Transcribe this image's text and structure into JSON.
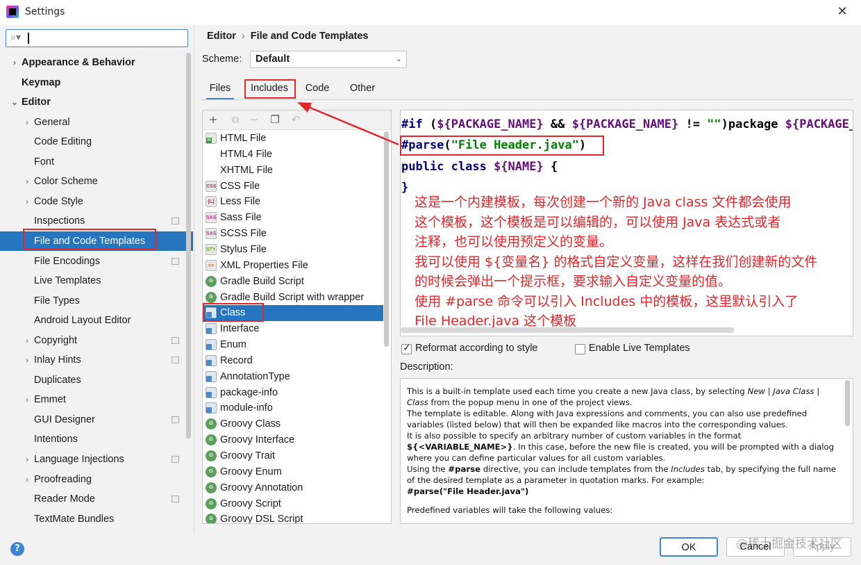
{
  "window": {
    "title": "Settings",
    "close_glyph": "✕"
  },
  "search": {
    "value": "",
    "icon": "search-icon"
  },
  "sidebar": {
    "items": [
      {
        "label": "Appearance & Behavior",
        "level": 0,
        "bold": true,
        "expander": "›"
      },
      {
        "label": "Keymap",
        "level": 0,
        "bold": true,
        "expander": ""
      },
      {
        "label": "Editor",
        "level": 0,
        "bold": true,
        "expander": "⌄"
      },
      {
        "label": "General",
        "level": 1,
        "expander": "›"
      },
      {
        "label": "Code Editing",
        "level": 1,
        "expander": ""
      },
      {
        "label": "Font",
        "level": 1,
        "expander": ""
      },
      {
        "label": "Color Scheme",
        "level": 1,
        "expander": "›"
      },
      {
        "label": "Code Style",
        "level": 1,
        "expander": "›"
      },
      {
        "label": "Inspections",
        "level": 1,
        "expander": "",
        "marker": true
      },
      {
        "label": "File and Code Templates",
        "level": 1,
        "expander": "",
        "selected": true
      },
      {
        "label": "File Encodings",
        "level": 1,
        "expander": "",
        "marker": true
      },
      {
        "label": "Live Templates",
        "level": 1,
        "expander": ""
      },
      {
        "label": "File Types",
        "level": 1,
        "expander": ""
      },
      {
        "label": "Android Layout Editor",
        "level": 1,
        "expander": ""
      },
      {
        "label": "Copyright",
        "level": 1,
        "expander": "›",
        "marker": true
      },
      {
        "label": "Inlay Hints",
        "level": 1,
        "expander": "›",
        "marker": true
      },
      {
        "label": "Duplicates",
        "level": 1,
        "expander": ""
      },
      {
        "label": "Emmet",
        "level": 1,
        "expander": "›"
      },
      {
        "label": "GUI Designer",
        "level": 1,
        "expander": "",
        "marker": true
      },
      {
        "label": "Intentions",
        "level": 1,
        "expander": ""
      },
      {
        "label": "Language Injections",
        "level": 1,
        "expander": "›",
        "marker": true
      },
      {
        "label": "Proofreading",
        "level": 1,
        "expander": "›"
      },
      {
        "label": "Reader Mode",
        "level": 1,
        "expander": "",
        "marker": true
      },
      {
        "label": "TextMate Bundles",
        "level": 1,
        "expander": ""
      }
    ]
  },
  "breadcrumb": {
    "parent": "Editor",
    "separator": "›",
    "current": "File and Code Templates"
  },
  "scheme": {
    "label": "Scheme:",
    "value": "Default",
    "dropdown_glyph": "⌄"
  },
  "tabs": [
    {
      "label": "Files",
      "active": true
    },
    {
      "label": "Includes"
    },
    {
      "label": "Code"
    },
    {
      "label": "Other"
    }
  ],
  "toolbar": {
    "add": "+",
    "copy": "⧉",
    "remove": "−",
    "duplicate": "❐",
    "reset": "↶"
  },
  "templates": [
    {
      "label": "HTML File",
      "icon": "html"
    },
    {
      "label": "HTML4 File",
      "icon": "html4"
    },
    {
      "label": "XHTML File",
      "icon": "xhtml"
    },
    {
      "label": "CSS File",
      "icon": "css",
      "glyph": "CSS"
    },
    {
      "label": "Less File",
      "icon": "less",
      "glyph": "{L}"
    },
    {
      "label": "Sass File",
      "icon": "sass",
      "glyph": "SASS"
    },
    {
      "label": "SCSS File",
      "icon": "sass",
      "glyph": "SASS"
    },
    {
      "label": "Stylus File",
      "icon": "styl",
      "glyph": "STYL"
    },
    {
      "label": "XML Properties File",
      "icon": "xml",
      "glyph": "<>"
    },
    {
      "label": "Gradle Build Script",
      "icon": "gradle",
      "glyph": "G"
    },
    {
      "label": "Gradle Build Script with wrapper",
      "icon": "gradle",
      "glyph": "G"
    },
    {
      "label": "Class",
      "icon": "java",
      "selected": true
    },
    {
      "label": "Interface",
      "icon": "java"
    },
    {
      "label": "Enum",
      "icon": "java"
    },
    {
      "label": "Record",
      "icon": "java"
    },
    {
      "label": "AnnotationType",
      "icon": "java"
    },
    {
      "label": "package-info",
      "icon": "java"
    },
    {
      "label": "module-info",
      "icon": "java"
    },
    {
      "label": "Groovy Class",
      "icon": "groovy",
      "glyph": "G"
    },
    {
      "label": "Groovy Interface",
      "icon": "groovy",
      "glyph": "G"
    },
    {
      "label": "Groovy Trait",
      "icon": "groovy",
      "glyph": "G"
    },
    {
      "label": "Groovy Enum",
      "icon": "groovy",
      "glyph": "G"
    },
    {
      "label": "Groovy Annotation",
      "icon": "groovy",
      "glyph": "G"
    },
    {
      "label": "Groovy Script",
      "icon": "groovy",
      "glyph": "G"
    },
    {
      "label": "Groovy DSL Script",
      "icon": "groovy",
      "glyph": "G"
    }
  ],
  "editor": {
    "line1": {
      "kw": "#if",
      "a": " (",
      "v1": "${PACKAGE_NAME}",
      "b": " && ",
      "v2": "${PACKAGE_NAME}",
      "c": " != ",
      "s": "\"\"",
      "d": ")package ",
      "v3": "${PACKAGE_NAME}"
    },
    "line2": {
      "kw": "#parse",
      "a": "(",
      "s": "\"File Header.java\"",
      "b": ")"
    },
    "line3": {
      "kw": "public class ",
      "v": "${NAME}",
      "b": " {"
    },
    "line4": "}"
  },
  "annotation": "这是一个内建模板，每次创建一个新的 Java class 文件都会使用\n这个模板，这个模板是可以编辑的，可以使用 Java 表达式或者\n注释，也可以使用预定义的变量。\n我可以使用 ${变量名} 的格式自定义变量，这样在我们创建新的文件\n的时候会弹出一个提示框，要求输入自定义变量的值。\n使用 #parse 命令可以引入 Includes 中的模板，这里默认引入了\nFile Header.java 这个模板",
  "options": {
    "reformat_label": "Reformat according to style",
    "reformat_checked": true,
    "live_label": "Enable Live Templates",
    "live_checked": false
  },
  "description": {
    "label": "Description:",
    "p1a": "This is a built-in template used each time you create a new Java class, by selecting ",
    "p1_new": "New",
    "p1_sep": " | ",
    "p1_jc": "Java Class",
    "p1_sep2": " | ",
    "p1_class": "Class",
    "p1b": " from the popup menu in one of the project views.",
    "p2": "The template is editable. Along with Java expressions and comments, you can also use predefined variables (listed below) that will then be expanded like macros into the corresponding values.",
    "p3a": "It is also possible to specify an arbitrary number of custom variables in the format ",
    "p3_var": "${<VARIABLE_NAME>}",
    "p3b": ". In this case, before the new file is created, you will be prompted with a dialog where you can define particular values for all custom variables.",
    "p4a": "Using the ",
    "p4_parse": "#parse",
    "p4b": " directive, you can include templates from the ",
    "p4_inc": "Includes",
    "p4c": " tab, by specifying the full name of the desired template as a parameter in quotation marks. For example:",
    "p5": "#parse(\"File Header.java\")",
    "p6": "Predefined variables will take the following values:"
  },
  "footer": {
    "help": "?",
    "ok": "OK",
    "cancel": "Cancel",
    "apply": "Apply",
    "watermark": "@稀土掘金技术社区"
  },
  "colors": {
    "accent": "#2675bf",
    "highlight_red": "#e3262b"
  }
}
